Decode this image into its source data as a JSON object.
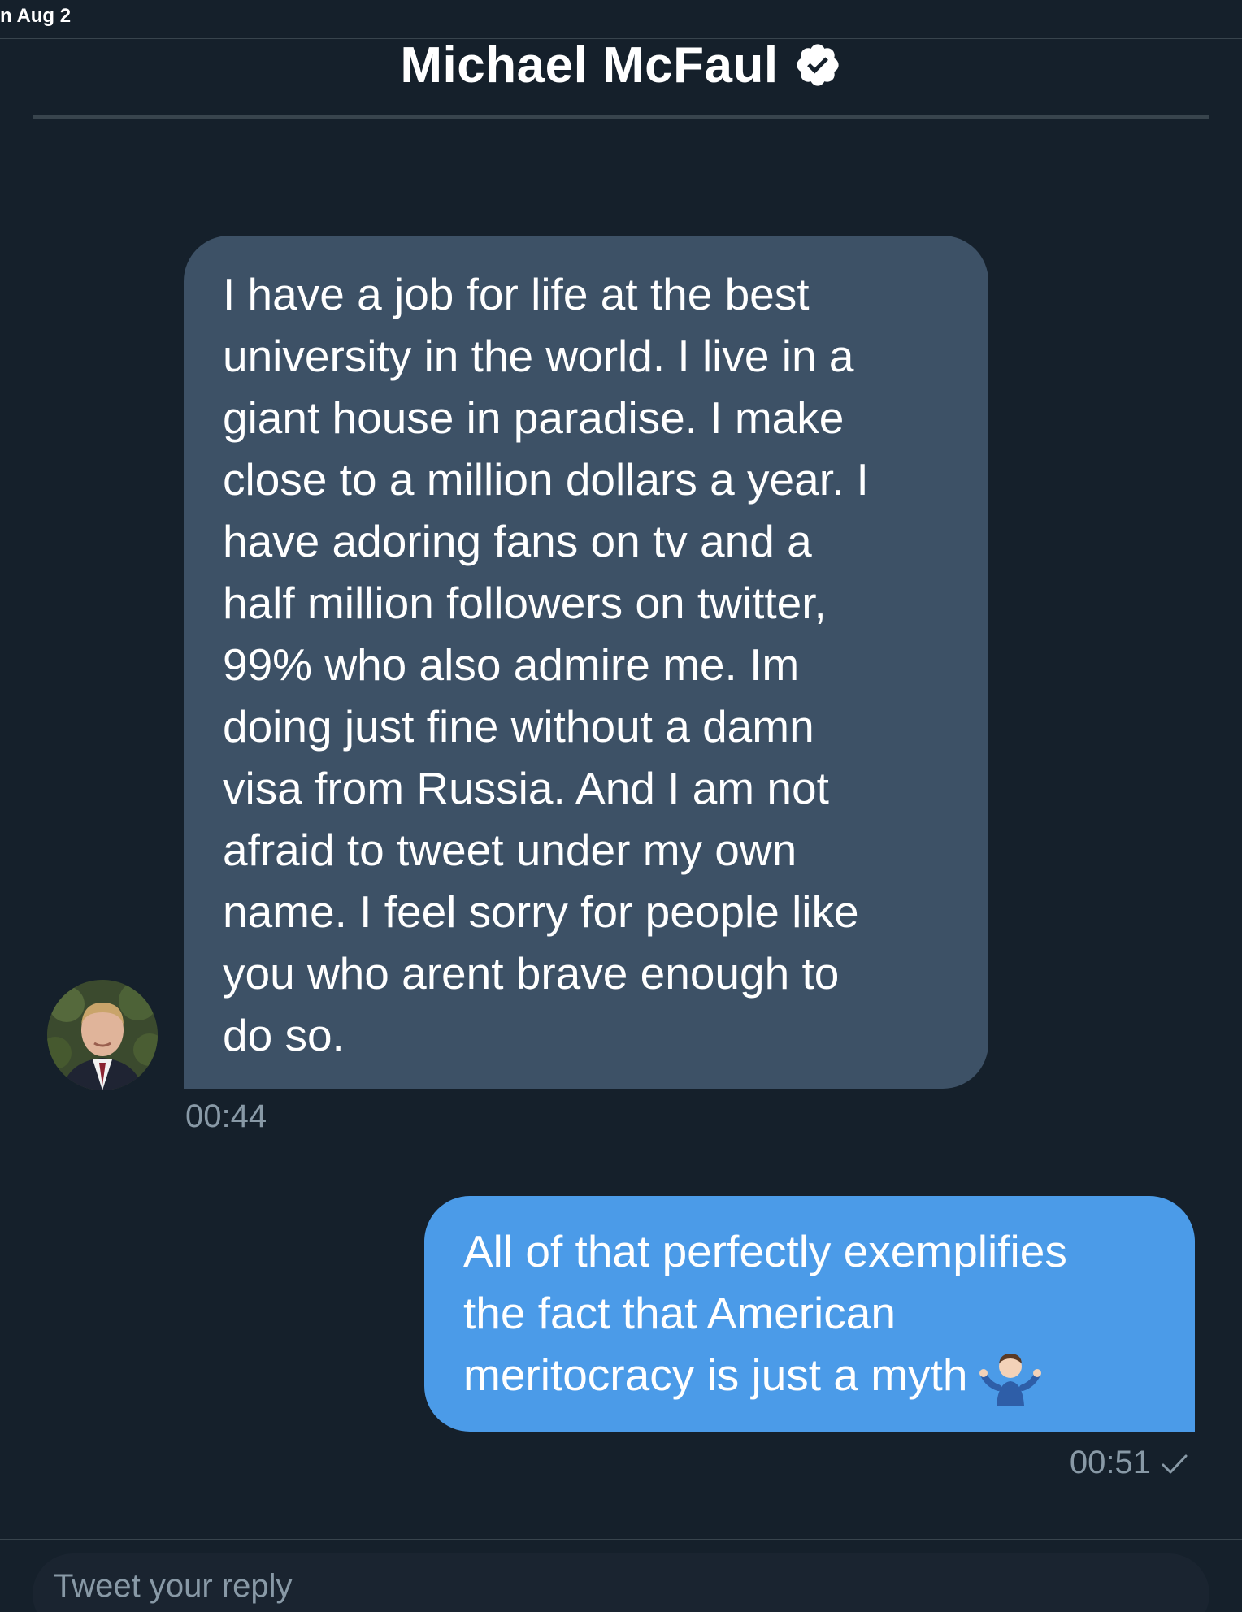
{
  "date_strip": {
    "label": "n Aug 2"
  },
  "header": {
    "name": "Michael McFaul",
    "verified_icon": "verified-badge-icon"
  },
  "messages": [
    {
      "direction": "incoming",
      "text": "I have a job for life at the best\nuniversity in the world. I live in a\ngiant house in paradise. I make\nclose to a million dollars a year. I\nhave adoring fans on tv and a\nhalf million followers on twitter,\n99% who also admire me.  Im\ndoing just fine without a damn\nvisa from Russia.  And I am not\nafraid to tweet under my own\nname.  I feel sorry for people like\nyou who arent brave enough to\ndo so.",
      "time": "00:44"
    },
    {
      "direction": "outgoing",
      "text": "All of that perfectly exemplifies\nthe fact that American\nmeritocracy is just a myth",
      "emoji": "person-shrugging-emoji",
      "time": "00:51",
      "status_icon": "check-icon"
    }
  ],
  "reply": {
    "placeholder": "Tweet your reply"
  },
  "colors": {
    "background": "#15202b",
    "incoming_bubble": "#3d5166",
    "outgoing_bubble": "#4b9be8",
    "muted_text": "#8899a6"
  }
}
